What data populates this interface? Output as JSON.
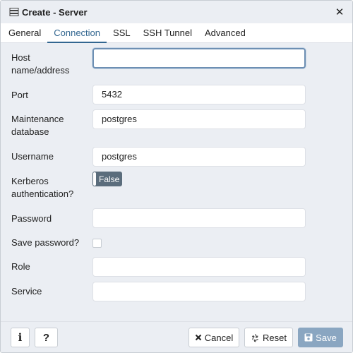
{
  "dialog": {
    "title": "Create - Server"
  },
  "tabs": [
    {
      "label": "General"
    },
    {
      "label": "Connection"
    },
    {
      "label": "SSL"
    },
    {
      "label": "SSH Tunnel"
    },
    {
      "label": "Advanced"
    }
  ],
  "active_tab": "Connection",
  "form": {
    "host": {
      "label": "Host name/address",
      "value": ""
    },
    "port": {
      "label": "Port",
      "value": "5432"
    },
    "maintenance_db": {
      "label": "Maintenance database",
      "value": "postgres"
    },
    "username": {
      "label": "Username",
      "value": "postgres"
    },
    "kerberos": {
      "label": "Kerberos authentication?",
      "value": "False"
    },
    "password": {
      "label": "Password",
      "value": ""
    },
    "save_password": {
      "label": "Save password?",
      "checked": false
    },
    "role": {
      "label": "Role",
      "value": ""
    },
    "service": {
      "label": "Service",
      "value": ""
    }
  },
  "footer": {
    "info_label": "i",
    "help_label": "?",
    "cancel_label": "Cancel",
    "reset_label": "Reset",
    "save_label": "Save"
  },
  "icons": {
    "title": "server-icon",
    "close": "close-icon",
    "cancel": "times-icon",
    "reset": "recycle-icon",
    "save": "floppy-disk-icon"
  },
  "colors": {
    "accent": "#326690",
    "panel": "#ebeef3",
    "toggle": "#5b6d7c",
    "save_button": "#8aa6c1"
  }
}
